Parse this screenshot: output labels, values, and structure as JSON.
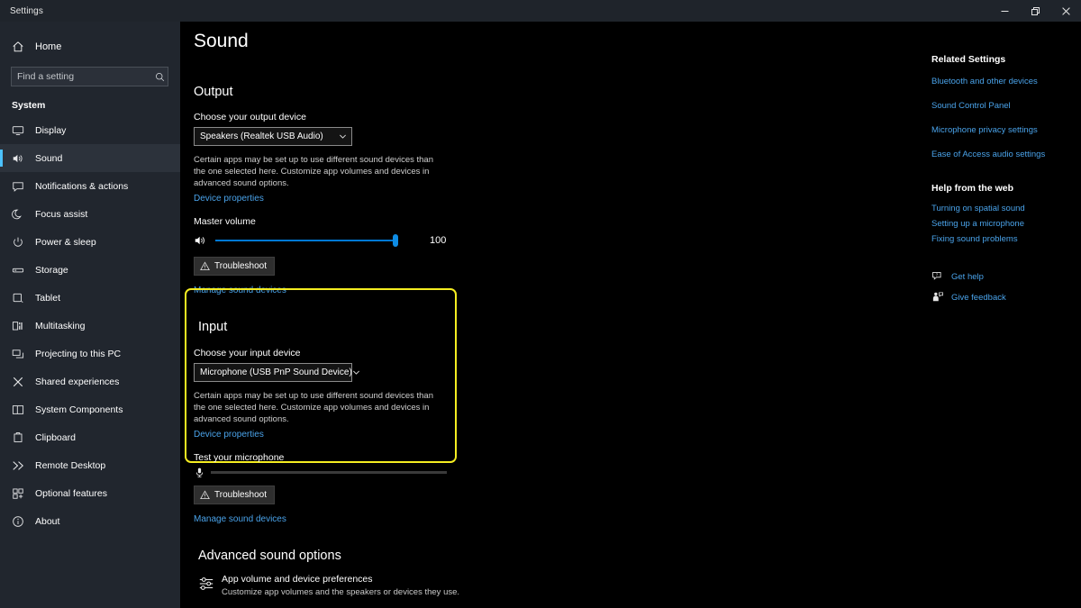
{
  "window": {
    "title": "Settings",
    "minimize_tooltip": "Minimize",
    "restore_tooltip": "Restore",
    "close_tooltip": "Close"
  },
  "sidebar": {
    "home_label": "Home",
    "search_placeholder": "Find a setting",
    "search_value": "",
    "group_title": "System",
    "items": [
      {
        "label": "Display",
        "icon": "monitor-icon",
        "selected": false
      },
      {
        "label": "Sound",
        "icon": "speaker-icon",
        "selected": true
      },
      {
        "label": "Notifications & actions",
        "icon": "notification-icon",
        "selected": false
      },
      {
        "label": "Focus assist",
        "icon": "moon-icon",
        "selected": false
      },
      {
        "label": "Power & sleep",
        "icon": "power-icon",
        "selected": false
      },
      {
        "label": "Storage",
        "icon": "drive-icon",
        "selected": false
      },
      {
        "label": "Tablet",
        "icon": "tablet-icon",
        "selected": false
      },
      {
        "label": "Multitasking",
        "icon": "multitasking-icon",
        "selected": false
      },
      {
        "label": "Projecting to this PC",
        "icon": "project-icon",
        "selected": false
      },
      {
        "label": "Shared experiences",
        "icon": "share-icon",
        "selected": false
      },
      {
        "label": "System Components",
        "icon": "components-icon",
        "selected": false
      },
      {
        "label": "Clipboard",
        "icon": "clipboard-icon",
        "selected": false
      },
      {
        "label": "Remote Desktop",
        "icon": "remote-desktop-icon",
        "selected": false
      },
      {
        "label": "Optional features",
        "icon": "features-icon",
        "selected": false
      },
      {
        "label": "About",
        "icon": "info-icon",
        "selected": false
      }
    ]
  },
  "page": {
    "title": "Sound"
  },
  "output": {
    "heading": "Output",
    "device_label": "Choose your output device",
    "device_value": "Speakers (Realtek USB Audio)",
    "helper_text": "Certain apps may be set up to use different sound devices than the one selected here. Customize app volumes and devices in advanced sound options.",
    "device_properties_link": "Device properties",
    "volume_label": "Master volume",
    "volume_value": "100",
    "volume_percent": 100,
    "troubleshoot_label": "Troubleshoot",
    "manage_link": "Manage sound devices"
  },
  "input": {
    "heading": "Input",
    "device_label": "Choose your input device",
    "device_value": "Microphone (USB PnP Sound Device)",
    "helper_text": "Certain apps may be set up to use different sound devices than the one selected here. Customize app volumes and devices in advanced sound options.",
    "device_properties_link": "Device properties",
    "test_label": "Test your microphone",
    "test_level_percent": 0,
    "troubleshoot_label": "Troubleshoot",
    "manage_link": "Manage sound devices",
    "highlight_color": "#f5ed21"
  },
  "advanced": {
    "heading": "Advanced sound options",
    "item_title": "App volume and device preferences",
    "item_subtitle": "Customize app volumes and the speakers or devices they use."
  },
  "rail": {
    "related_heading": "Related Settings",
    "related_links": [
      "Bluetooth and other devices",
      "Sound Control Panel",
      "Microphone privacy settings",
      "Ease of Access audio settings"
    ],
    "help_heading": "Help from the web",
    "help_links": [
      "Turning on spatial sound",
      "Setting up a microphone",
      "Fixing sound problems"
    ],
    "get_help_label": "Get help",
    "give_feedback_label": "Give feedback"
  },
  "colors": {
    "accent": "#0078d4",
    "link": "#4aa3ea",
    "sidebar_bg": "#21262e",
    "main_bg": "#000000",
    "highlight": "#f5ed21"
  }
}
